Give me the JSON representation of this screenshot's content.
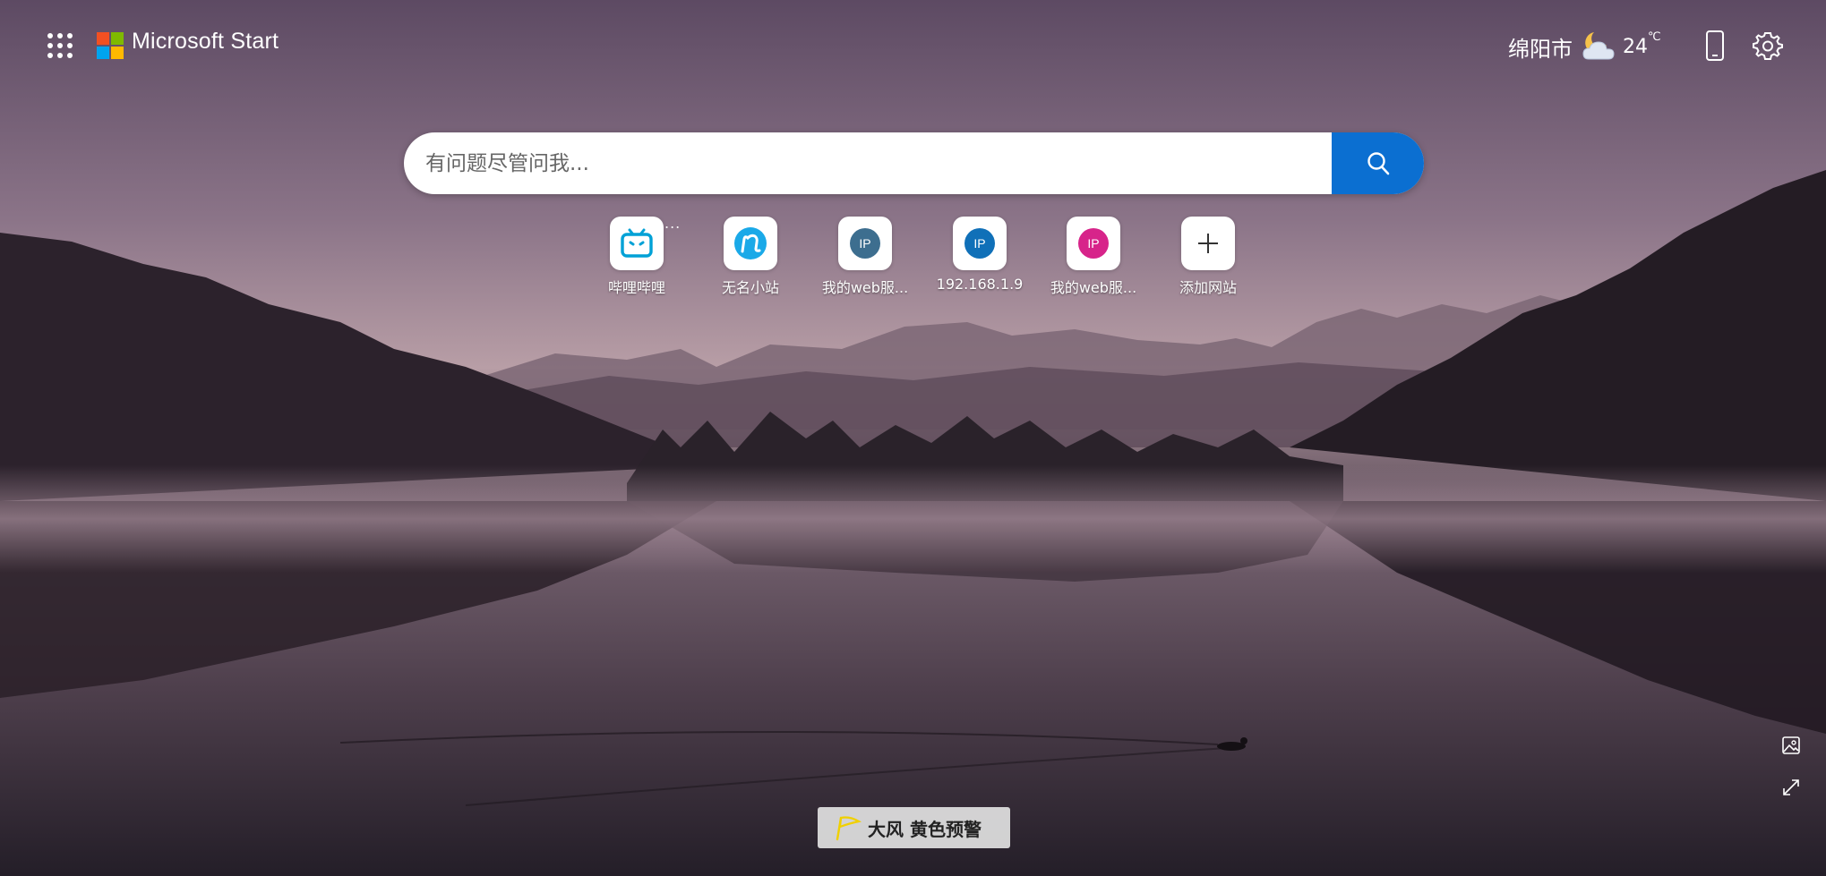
{
  "header": {
    "brand": "Microsoft Start",
    "apps_icon": "apps-grid-icon"
  },
  "weather": {
    "city": "绵阳市",
    "temp": "24",
    "unit": "℃",
    "icon": "partly-cloudy-night-icon"
  },
  "search": {
    "placeholder": "有问题尽管问我..."
  },
  "quick_links": [
    {
      "label": "哔哩哔哩",
      "icon": "bilibili-icon"
    },
    {
      "label": "无名小站",
      "icon": "n-logo-icon"
    },
    {
      "label": "我的web服...",
      "icon": "ip-icon",
      "badge": "IP",
      "color": "#3d6e8f"
    },
    {
      "label": "192.168.1.9",
      "icon": "ip-icon",
      "badge": "IP",
      "color": "#1070b8"
    },
    {
      "label": "我的web服...",
      "icon": "ip-icon",
      "badge": "IP",
      "color": "#d7248a"
    },
    {
      "label": "添加网站",
      "icon": "plus-icon"
    }
  ],
  "more": "...",
  "alert": {
    "text": "大风 黄色预警",
    "color": "#f0d000"
  },
  "colors": {
    "search_button": "#0b6fd1",
    "ms_red": "#f25022",
    "ms_green": "#7fba00",
    "ms_blue": "#00a4ef",
    "ms_yellow": "#ffb900"
  }
}
